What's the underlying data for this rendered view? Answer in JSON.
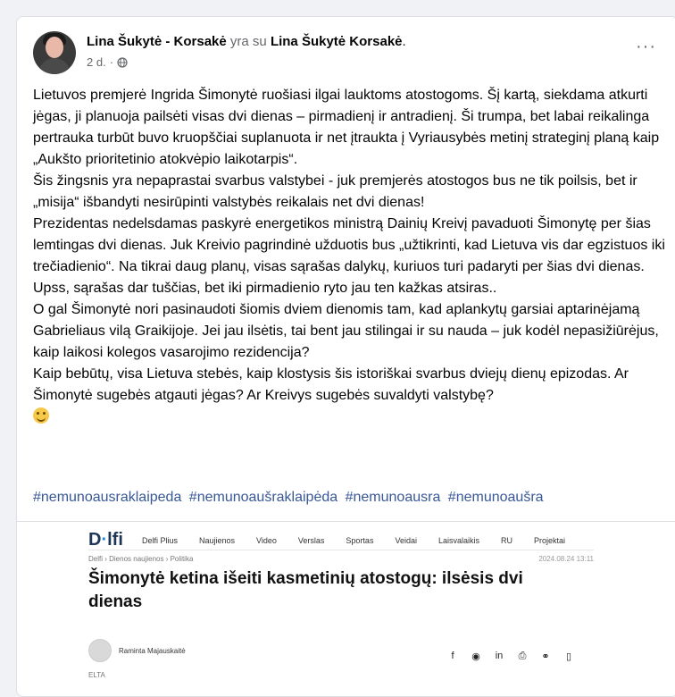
{
  "post": {
    "author": "Lina Šukytė - Korsakė",
    "with_text": "yra su",
    "tagged": "Lina Šukytė Korsakė",
    "tagged_suffix": ".",
    "time": "2 d.",
    "time_sep": "·",
    "more": "···",
    "paragraphs": [
      "Lietuvos premjerė Ingrida Šimonytė ruošiasi ilgai lauktoms atostogoms. Šį kartą, siekdama atkurti jėgas, ji planuoja pailsėti visas dvi dienas – pirmadienį ir antradienį. Ši trumpa, bet labai reikalinga pertrauka turbūt buvo kruopščiai suplanuota ir net įtraukta į Vyriausybės metinį strateginį planą kaip „Aukšto prioritetinio atokvėpio laikotarpis“.",
      "Šis žingsnis yra nepaprastai svarbus valstybei - juk premjerės atostogos bus ne tik poilsis, bet ir „misija“ išbandyti nesirūpinti valstybės reikalais net dvi dienas!",
      "Prezidentas nedelsdamas paskyrė energetikos ministrą Dainių Kreivį pavaduoti Šimonytę per šias lemtingas dvi dienas. Juk Kreivio pagrindinė užduotis bus „užtikrinti, kad Lietuva vis dar egzistuos iki trečiadienio“. Na tikrai daug planų, visas sąrašas dalykų, kuriuos turi padaryti per šias dvi dienas. Upss, sąrašas dar tuščias, bet iki pirmadienio ryto jau ten kažkas atsiras..",
      "O gal Šimonytė nori pasinaudoti šiomis dviem dienomis tam, kad aplankytų garsiai aptarinėjamą Gabrieliaus vilą Graikijoje. Jei jau ilsėtis, tai bent jau stilingai ir su nauda – juk kodėl nepasižiūrėjus, kaip laikosi kolegos vasarojimo rezidencija?",
      "Kaip bebūtų, visa Lietuva stebės, kaip klostysis šis istoriškai svarbus dviejų dienų epizodas. Ar Šimonytė sugebės atgauti jėgas? Ar Kreivys sugebės suvaldyti valstybę?"
    ],
    "emoji": "slightly-smiling-face",
    "hashtags": [
      "#nemunoausraklaipeda",
      "#nemunoaušraklaipėda",
      "#nemunoausra",
      "#nemunoaušra"
    ]
  },
  "preview": {
    "logo_d": "D",
    "logo_dot": "·",
    "logo_rest": "lfi",
    "nav": [
      "Delfi Plius",
      "Naujienos",
      "Video",
      "Verslas",
      "Sportas",
      "Veidai",
      "Laisvalaikis",
      "RU",
      "Projektai"
    ],
    "breadcrumb": "Delfi › Dienos naujienos › Politika",
    "date": "2024.08.24 13:11",
    "headline": "Šimonytė ketina išeiti kasmetinių atostogų: ilsėsis dvi dienas",
    "author": "Raminta Majauskaitė",
    "share_icons": [
      "f",
      "m",
      "in",
      "print",
      "link",
      "bookmark"
    ],
    "source": "ELTA"
  },
  "colors": {
    "link": "#385898",
    "muted": "#65676b",
    "card_bg": "#ffffff",
    "page_bg": "#f0f2f5"
  }
}
